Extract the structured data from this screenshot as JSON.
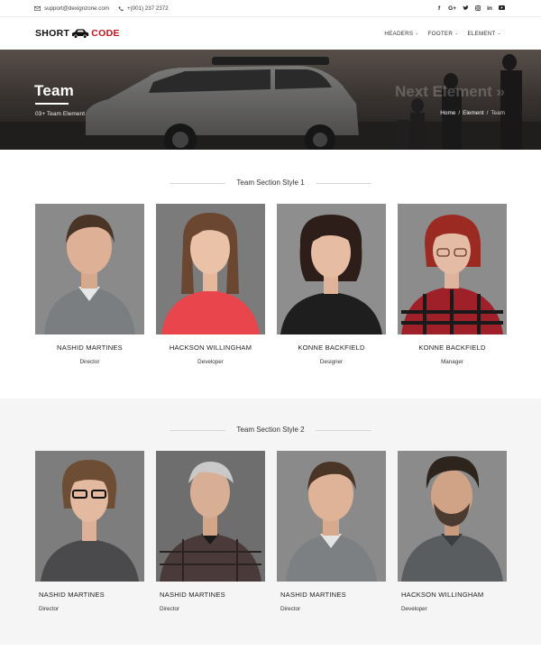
{
  "topbar": {
    "email": "support@dexignzone.com",
    "phone": "+(001) 237 2372",
    "social": [
      "f",
      "G+",
      "t",
      "ig",
      "in",
      "yt"
    ]
  },
  "header": {
    "logo_part1": "SHORT",
    "logo_part2": "CODE",
    "nav": [
      {
        "label": "HEADERS"
      },
      {
        "label": "FOOTER"
      },
      {
        "label": "ELEMENT"
      }
    ]
  },
  "hero": {
    "title": "Team",
    "subtitle": "03+ Team Element",
    "ghost_text": "Next Element »",
    "breadcrumb": [
      "Home",
      "Element",
      "Team"
    ]
  },
  "section1": {
    "title": "Team Section Style 1",
    "members": [
      {
        "name": "NASHID MARTINES",
        "role": "Director"
      },
      {
        "name": "HACKSON WILLINGHAM",
        "role": "Developer"
      },
      {
        "name": "KONNE BACKFIELD",
        "role": "Designer"
      },
      {
        "name": "KONNE BACKFIELD",
        "role": "Manager"
      }
    ]
  },
  "section2": {
    "title": "Team Section Style 2",
    "members": [
      {
        "name": "NASHID MARTINES",
        "role": "Director"
      },
      {
        "name": "NASHID MARTINES",
        "role": "Director"
      },
      {
        "name": "NASHID MARTINES",
        "role": "Director"
      },
      {
        "name": "HACKSON WILLINGHAM",
        "role": "Developer"
      }
    ]
  },
  "colors": {
    "brand_red": "#c5161d",
    "text_dark": "#222222",
    "section_alt_bg": "#f5f5f5"
  }
}
